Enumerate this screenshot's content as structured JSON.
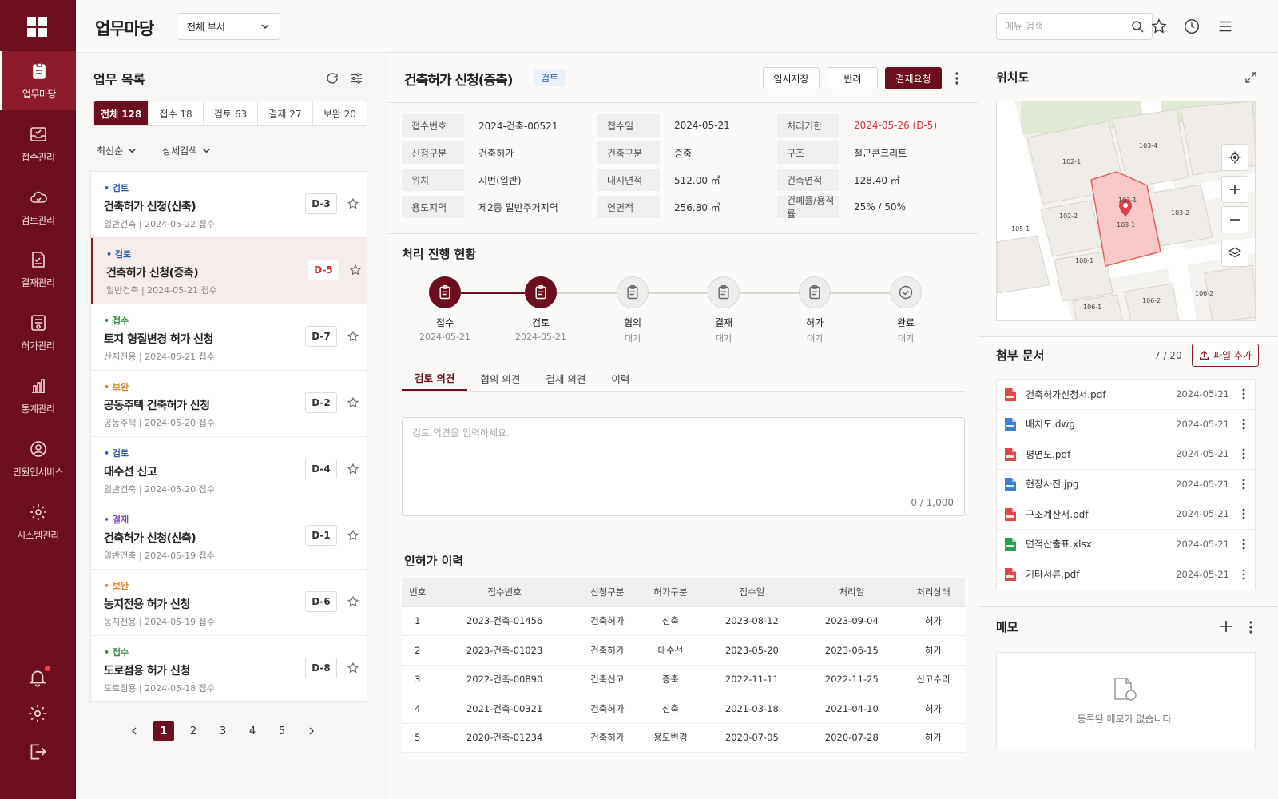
{
  "app": {
    "title": "업무마당",
    "dept_select": "전체 부서",
    "search_placeholder": "메뉴 검색"
  },
  "rail": {
    "items": [
      {
        "label": "업무마당",
        "icon": "clipboard-icon",
        "active": true
      },
      {
        "label": "접수관리",
        "icon": "inbox-check-icon"
      },
      {
        "label": "검토관리",
        "icon": "cloud-review-icon"
      },
      {
        "label": "결재관리",
        "icon": "approval-doc-icon"
      },
      {
        "label": "허가관리",
        "icon": "permit-icon"
      },
      {
        "label": "통계관리",
        "icon": "bar-chart-icon"
      },
      {
        "label": "민원인서비스",
        "icon": "civil-service-icon"
      },
      {
        "label": "시스템관리",
        "icon": "gear-icon"
      }
    ]
  },
  "list": {
    "title": "업무 목록",
    "filters": [
      "전체 128",
      "접수 18",
      "검토 63",
      "결재 27",
      "보완 20"
    ],
    "sort": "최신순",
    "detail_search": "상세검색",
    "items": [
      {
        "status": "검토",
        "status_color": "#2f5fa8",
        "title": "건축허가 신청(신축)",
        "meta": "일반건축 | 2024-05-22 접수",
        "due": "D-3",
        "due_color": "#333"
      },
      {
        "status": "검토",
        "status_color": "#2f5fa8",
        "title": "건축허가 신청(증축)",
        "meta": "일반건축 | 2024-05-21 접수",
        "due": "D-5",
        "due_color": "#c8323c"
      },
      {
        "status": "접수",
        "status_color": "#2e8b3e",
        "title": "토지 형질변경 허가 신청",
        "meta": "산지전용 | 2024-05-21 접수",
        "due": "D-7",
        "due_color": "#333"
      },
      {
        "status": "보완",
        "status_color": "#d9822b",
        "title": "공동주택 건축허가 신청",
        "meta": "공동주택 | 2024-05-20 접수",
        "due": "D-2",
        "due_color": "#333"
      },
      {
        "status": "검토",
        "status_color": "#2f5fa8",
        "title": "대수선 신고",
        "meta": "일반건축 | 2024-05-20 접수",
        "due": "D-4",
        "due_color": "#333"
      },
      {
        "status": "결재",
        "status_color": "#8a4bb8",
        "title": "건축허가 신청(신축)",
        "meta": "일반건축 | 2024-05-19 접수",
        "due": "D-1",
        "due_color": "#333"
      },
      {
        "status": "보완",
        "status_color": "#d9822b",
        "title": "농지전용 허가 신청",
        "meta": "농지전용 | 2024-05-19 접수",
        "due": "D-6",
        "due_color": "#333"
      },
      {
        "status": "접수",
        "status_color": "#2e8b3e",
        "title": "도로점용 허가 신청",
        "meta": "도로점용 | 2024-05-18 접수",
        "due": "D-8",
        "due_color": "#333"
      }
    ],
    "pages": [
      "1",
      "2",
      "3",
      "4",
      "5"
    ]
  },
  "detail": {
    "title": "건축허가 신청(증축)",
    "badge": "검토",
    "buttons": {
      "save": "임시저장",
      "reject": "반려",
      "approve": "결재요청"
    },
    "info": [
      [
        [
          "접수번호",
          "2024-건축-00521"
        ],
        [
          "접수일",
          "2024-05-21"
        ],
        [
          "처리기한",
          "2024-05-26 (D-5)"
        ]
      ],
      [
        [
          "신청구분",
          "건축허가"
        ],
        [
          "건축구분",
          "증축"
        ],
        [
          "구조",
          "철근콘크리트"
        ]
      ],
      [
        [
          "위치",
          "지번(일반)"
        ],
        [
          "대지면적",
          "512.00 ㎡"
        ],
        [
          "건축면적",
          "128.40 ㎡"
        ]
      ],
      [
        [
          "용도지역",
          "제2종 일반주거지역"
        ],
        [
          "연면적",
          "256.80 ㎡"
        ],
        [
          "건폐율/용적률",
          "25% / 50%"
        ]
      ]
    ],
    "deadline_color": "#d2343f",
    "progress_title": "처리 진행 현황",
    "steps": [
      {
        "label": "접수",
        "sub": "2024-05-21",
        "done": true
      },
      {
        "label": "검토",
        "sub": "2024-05-21",
        "done": true
      },
      {
        "label": "협의",
        "sub": "대기"
      },
      {
        "label": "결재",
        "sub": "대기"
      },
      {
        "label": "허가",
        "sub": "대기"
      },
      {
        "label": "완료",
        "sub": "대기"
      }
    ],
    "opinion_tabs": [
      "검토 의견",
      "협의 의견",
      "결재 의견",
      "이력"
    ],
    "opinion_placeholder": "검토 의견을 입력하세요.",
    "opinion_count": "0 / 1,000",
    "history_title": "인허가 이력",
    "history_headers": [
      "번호",
      "접수번호",
      "신청구분",
      "허가구분",
      "접수일",
      "처리일",
      "처리상태"
    ],
    "history_rows": [
      [
        "1",
        "2023-건축-01456",
        "건축허가",
        "신축",
        "2023-08-12",
        "2023-09-04",
        "허가"
      ],
      [
        "2",
        "2023-건축-01023",
        "건축허가",
        "대수선",
        "2023-05-20",
        "2023-06-15",
        "허가"
      ],
      [
        "3",
        "2022-건축-00890",
        "건축신고",
        "증축",
        "2022-11-11",
        "2022-11-25",
        "신고수리"
      ],
      [
        "4",
        "2021-건축-00321",
        "건축허가",
        "신축",
        "2021-03-18",
        "2021-04-10",
        "허가"
      ],
      [
        "5",
        "2020-건축-01234",
        "건축허가",
        "용도변경",
        "2020-07-05",
        "2020-07-28",
        "허가"
      ]
    ]
  },
  "map": {
    "title": "위치도",
    "parcels": [
      "103-1",
      "103-4",
      "102-1",
      "102-2",
      "103-2",
      "105-1",
      "103-1",
      "108-1",
      "106-1",
      "106-2",
      "106-2"
    ]
  },
  "attach": {
    "title": "첨부 문서",
    "count": "7 / 20",
    "add": "파일 추가",
    "files": [
      {
        "name": "건축허가신청서.pdf",
        "date": "2024-05-21",
        "type": "pdf",
        "color": "#e0474c"
      },
      {
        "name": "배치도.dwg",
        "date": "2024-05-21",
        "type": "dwg",
        "color": "#3f7fd6"
      },
      {
        "name": "평면도.pdf",
        "date": "2024-05-21",
        "type": "pdf",
        "color": "#e0474c"
      },
      {
        "name": "현장사진.jpg",
        "date": "2024-05-21",
        "type": "jpg",
        "color": "#3f7fd6"
      },
      {
        "name": "구조계산서.pdf",
        "date": "2024-05-21",
        "type": "pdf",
        "color": "#e0474c"
      },
      {
        "name": "면적산출표.xlsx",
        "date": "2024-05-21",
        "type": "xls",
        "color": "#2e9e4f"
      },
      {
        "name": "기타서류.pdf",
        "date": "2024-05-21",
        "type": "pdf",
        "color": "#e0474c"
      }
    ]
  },
  "memo": {
    "title": "메모",
    "empty": "등록된 메모가 없습니다."
  }
}
